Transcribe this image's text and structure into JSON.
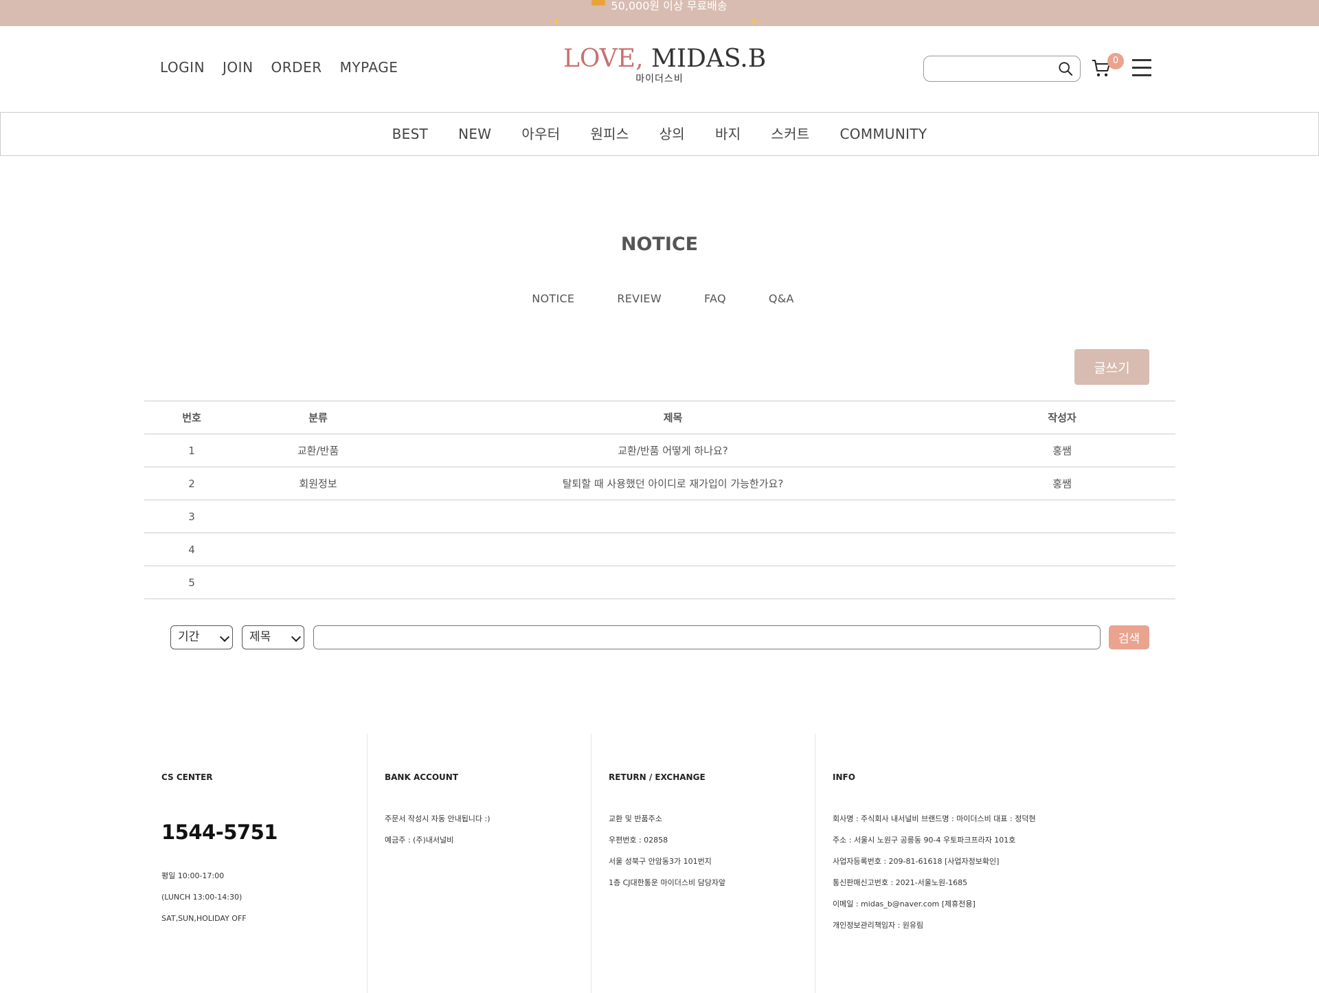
{
  "banner": {
    "text": "50,000원 이상 무료배송"
  },
  "header": {
    "links": [
      "LOGIN",
      "JOIN",
      "ORDER",
      "MYPAGE"
    ],
    "logo_love": "LOVE,",
    "logo_brand": "MIDAS.B",
    "logo_sub": "마이더스비",
    "cart_count": "0"
  },
  "nav": {
    "items": [
      "BEST",
      "NEW",
      "아우터",
      "원피스",
      "상의",
      "바지",
      "스커트",
      "COMMUNITY"
    ]
  },
  "page": {
    "title": "NOTICE",
    "tabs": [
      "NOTICE",
      "REVIEW",
      "FAQ",
      "Q&A"
    ],
    "write_label": "글쓰기"
  },
  "board": {
    "columns": [
      "번호",
      "분류",
      "제목",
      "작성자"
    ],
    "rows": [
      [
        "1",
        "교환/반품",
        "교환/반품 어떻게 하나요?",
        "홍쌤"
      ],
      [
        "2",
        "회원정보",
        "탈퇴할 때 사용했던 아이디로 재가입이 가능한가요?",
        "홍쌤"
      ],
      [
        "3",
        "",
        "",
        ""
      ],
      [
        "4",
        "",
        "",
        ""
      ],
      [
        "5",
        "",
        "",
        ""
      ]
    ]
  },
  "search": {
    "period_value": "기간",
    "field_value": "제목",
    "keyword_value": "",
    "button_label": "검색"
  },
  "footer": {
    "cs": {
      "heading": "CS CENTER",
      "phone": "1544-5751",
      "lines": [
        "평일 10:00-17:00",
        "(LUNCH 13:00-14:30)",
        "SAT,SUN,HOLIDAY OFF"
      ]
    },
    "bank": {
      "heading": "BANK ACCOUNT",
      "lines": [
        "주문서 작성시 자동 안내됩니다 :)",
        "예금주 : (주)내서널비"
      ]
    },
    "return": {
      "heading": "RETURN / EXCHANGE",
      "lines": [
        "교환 및 반품주소",
        "우편번호 : 02858",
        "서울 성북구 안암동3가 101번지",
        "1층 CJ대한통운 마이더스비 담당자앞"
      ]
    },
    "info": {
      "heading": "INFO",
      "lines": [
        "회사명 : 주식회사 내서널비 브랜드명 : 마이더스비 대표 : 정덕현",
        "주소 : 서울시 노원구 공릉동 90-4 우토파크프라자 101호",
        "사업자등록번호 : 209-81-61618 [사업자정보확인]",
        "통신판매신고번호 : 2021-서울노원-1685",
        "이메일 : midas_b@naver.com [제휴전용]",
        "개인정보관리책임자 : 원유림"
      ]
    }
  },
  "colors": {
    "banner_bg": "#d8bcb1",
    "accent": "#e9a38f",
    "logo_love": "#c9706f"
  }
}
